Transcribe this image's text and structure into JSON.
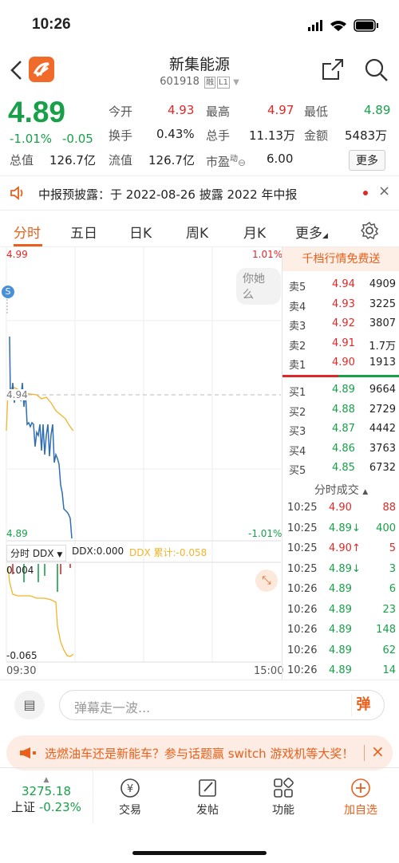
{
  "status": {
    "time": "10:26"
  },
  "header": {
    "title": "新集能源",
    "code": "601918",
    "tag1": "融",
    "tag2": "L1"
  },
  "quote": {
    "price": "4.89",
    "change_pct": "-1.01%",
    "change": "-0.05",
    "open_label": "今开",
    "open": "4.93",
    "high_label": "最高",
    "high": "4.97",
    "low_label": "最低",
    "low": "4.89",
    "turnover_label": "换手",
    "turnover": "0.43%",
    "volume_label": "总手",
    "volume": "11.13万",
    "amount_label": "金额",
    "amount": "5483万",
    "mktcap_label": "总值",
    "mktcap": "126.7亿",
    "float_label": "流值",
    "float": "126.7亿",
    "pe_label": "市盈",
    "pe_sup": "动",
    "pe": "6.00",
    "more": "更多"
  },
  "notice": {
    "text": "中报预披露：于 2022-08-26 披露 2022 年中报"
  },
  "tabs": [
    "分时",
    "五日",
    "日K",
    "周K",
    "月K",
    "更多"
  ],
  "chart": {
    "top_price": "4.99",
    "top_pct": "1.01%",
    "mid_price": "4.94",
    "bottom_price": "4.89",
    "bottom_pct": "-1.01%",
    "bubble": "你她么",
    "s_badge": "S",
    "ddx_selector": "分时 DDX",
    "ddx_value": "DDX:0.000",
    "ddx_total": "DDX 累计:-0.058",
    "ddx_top": "0.004",
    "ddx_bottom": "-0.065",
    "time_start": "09:30",
    "time_end": "15:00"
  },
  "orderbook": {
    "header": "千档行情免费送",
    "asks": [
      {
        "label": "卖5",
        "price": "4.94",
        "vol": "4909"
      },
      {
        "label": "卖4",
        "price": "4.93",
        "vol": "3225"
      },
      {
        "label": "卖3",
        "price": "4.92",
        "vol": "3807"
      },
      {
        "label": "卖2",
        "price": "4.91",
        "vol": "1.7万"
      },
      {
        "label": "卖1",
        "price": "4.90",
        "vol": "1913"
      }
    ],
    "bids": [
      {
        "label": "买1",
        "price": "4.89",
        "vol": "9664"
      },
      {
        "label": "买2",
        "price": "4.88",
        "vol": "2729"
      },
      {
        "label": "买3",
        "price": "4.87",
        "vol": "4442"
      },
      {
        "label": "买4",
        "price": "4.86",
        "vol": "3763"
      },
      {
        "label": "买5",
        "price": "4.85",
        "vol": "6732"
      }
    ],
    "trades_header": "分时成交",
    "trades": [
      {
        "time": "10:25",
        "price": "4.90",
        "vol": "88"
      },
      {
        "time": "10:25",
        "price": "4.89↓",
        "vol": "400"
      },
      {
        "time": "10:25",
        "price": "4.90↑",
        "vol": "5"
      },
      {
        "time": "10:25",
        "price": "4.89↓",
        "vol": "3"
      },
      {
        "time": "10:26",
        "price": "4.89",
        "vol": "6"
      },
      {
        "time": "10:26",
        "price": "4.89",
        "vol": "23"
      },
      {
        "time": "10:26",
        "price": "4.89",
        "vol": "148"
      },
      {
        "time": "10:26",
        "price": "4.89",
        "vol": "62"
      },
      {
        "time": "10:26",
        "price": "4.89",
        "vol": "14"
      }
    ]
  },
  "danmaku": {
    "placeholder": "弹幕走一波...",
    "send": "弹"
  },
  "banner": {
    "text": "选燃油车还是新能车？参与话题赢 switch 游戏机等大奖！"
  },
  "bottom": {
    "index_value": "3275.18",
    "index_name": "上证",
    "index_pct": "-0.23%",
    "trade": "交易",
    "post": "发帖",
    "func": "功能",
    "add": "加自选"
  }
}
